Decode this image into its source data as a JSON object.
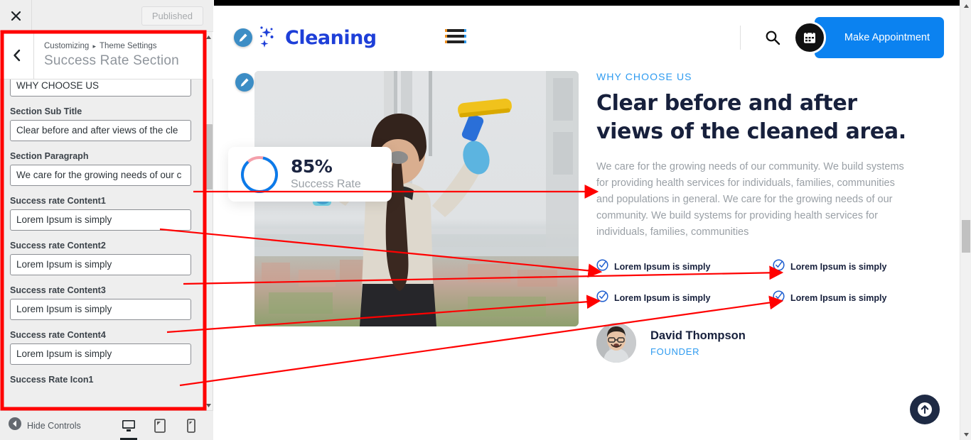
{
  "customizer": {
    "close_icon": "close-icon",
    "publish_label": "Published",
    "back_icon": "chevron-left-icon",
    "breadcrumb_root": "Customizing",
    "breadcrumb_sep": "▸",
    "breadcrumb_parent": "Theme Settings",
    "section_title": "Success Rate Section",
    "fields": [
      {
        "label": "",
        "value": "WHY CHOOSE US",
        "clipped": true
      },
      {
        "label": "Section Sub Title",
        "value": "Clear before and after views of the cle"
      },
      {
        "label": "Section Paragraph",
        "value": "We care for the growing needs of our c"
      },
      {
        "label": "Success rate Content1",
        "value": "Lorem Ipsum is simply"
      },
      {
        "label": "Success rate Content2",
        "value": "Lorem Ipsum is simply"
      },
      {
        "label": "Success rate Content3",
        "value": "Lorem Ipsum is simply"
      },
      {
        "label": "Success rate Content4",
        "value": "Lorem Ipsum is simply"
      }
    ],
    "hide_controls_label": "Hide Controls",
    "devices": [
      "desktop-icon",
      "tablet-icon",
      "mobile-icon"
    ]
  },
  "site": {
    "brand_name": "Cleaning",
    "brand_color": "#1e3fd8",
    "menu_icon": "hamburger-menu-icon",
    "search_icon": "search-icon",
    "appointment_label": "Make Appointment",
    "appointment_icon": "calendar-icon",
    "accent_color": "#0b82f0"
  },
  "hero": {
    "image_alt": "woman-cleaning-window-with-squeegee",
    "edit_icon": "pencil-edit-icon",
    "rate_value": "85%",
    "rate_label": "Success Rate",
    "rate_percent": 85,
    "ring_color": "#0b7bea",
    "ring_rest_color": "#f4a0ab"
  },
  "content": {
    "eyebrow": "WHY CHOOSE US",
    "headline": "Clear before and after views of the cleaned area.",
    "paragraph": "We care for the growing needs of our community. We build systems for providing health services for individuals, families, communities and populations in general. We care for the growing needs of our community. We build systems for providing health services for individuals, families, communities",
    "checks": [
      {
        "icon": "check-circle-icon",
        "text": "Lorem Ipsum is simply"
      },
      {
        "icon": "check-circle-icon",
        "text": "Lorem Ipsum is simply"
      },
      {
        "icon": "check-circle-icon",
        "text": "Lorem Ipsum is simply"
      },
      {
        "icon": "check-circle-icon",
        "text": "Lorem Ipsum is simply"
      }
    ],
    "author_name": "David Thompson",
    "author_role": "FOUNDER",
    "author_avatar": "avatar-photo"
  },
  "misc": {
    "scroll_top_icon": "arrow-up-icon",
    "annotation_color": "#ff0000"
  }
}
